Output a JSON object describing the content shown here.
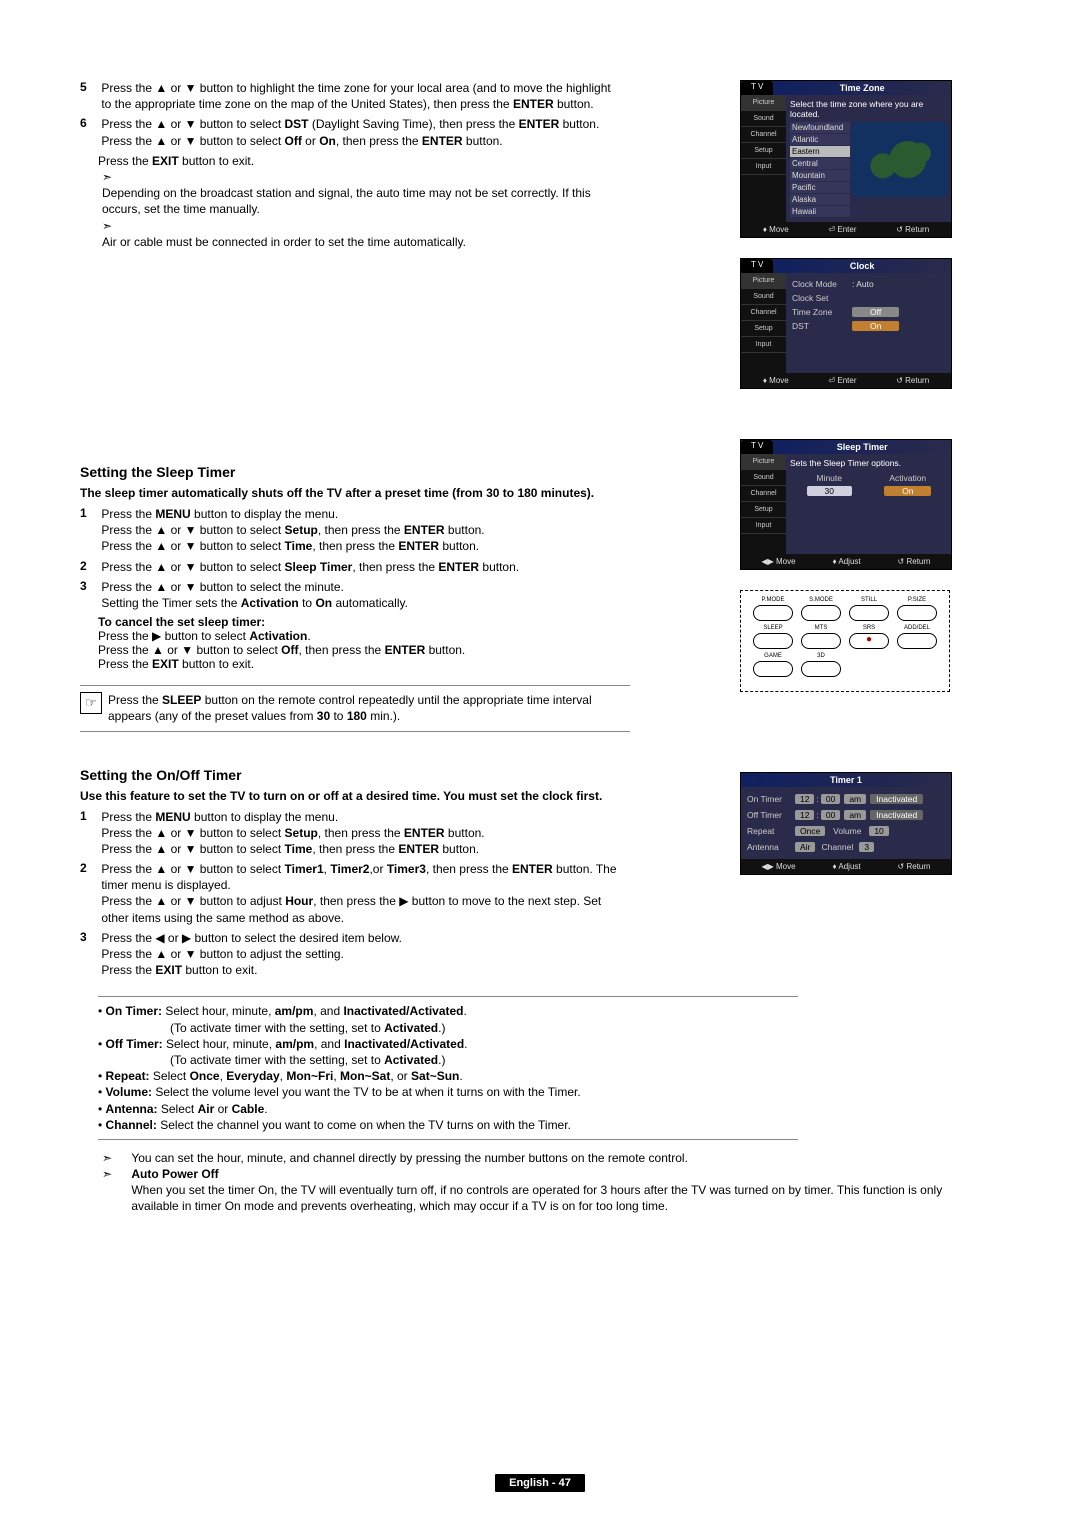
{
  "steps_top": {
    "n5": "5",
    "t5_a": "Press the ▲ or ▼ button to highlight the time zone for your local area (and to move the highlight to the appropriate time zone on the map of the United States), then press the ",
    "t5_b": "ENTER",
    "t5_c": " button.",
    "n6": "6",
    "t6_a": "Press the ▲ or ▼ button to select ",
    "t6_b": "DST",
    "t6_c": " (Daylight Saving Time), then press the ",
    "t6_d": "ENTER",
    "t6_e": " button. Press the ▲ or ▼ button to select ",
    "t6_f": "Off",
    "t6_g": " or ",
    "t6_h": "On",
    "t6_i": ", then press the ",
    "t6_j": "ENTER",
    "t6_k": " button.",
    "exit_a": "Press the ",
    "exit_b": "EXIT",
    "exit_c": " button to exit.",
    "arrow1": "Depending on the broadcast station and signal, the auto time may not be set correctly. If this occurs, set the time manually.",
    "arrow2": "Air or cable must be connected in order to set the time automatically."
  },
  "sleep": {
    "heading": "Setting the Sleep Timer",
    "intro": "The sleep timer automatically shuts off the TV after a preset time (from 30 to 180 minutes).",
    "n1": "1",
    "s1a": "Press the ",
    "s1b": "MENU",
    "s1c": " button to display the menu.",
    "s1d": "Press the ▲ or ▼ button to select ",
    "s1e": "Setup",
    "s1f": ", then press the ",
    "s1g": "ENTER",
    "s1h": " button.",
    "s1i": "Press the ▲ or ▼ button to select ",
    "s1j": "Time",
    "s1k": ", then press the ",
    "s1l": "ENTER",
    "s1m": " button.",
    "n2": "2",
    "s2a": "Press the ▲ or ▼ button to select ",
    "s2b": "Sleep Timer",
    "s2c": ", then press the ",
    "s2d": "ENTER",
    "s2e": " button.",
    "n3": "3",
    "s3a": "Press the ▲ or ▼ button to select the minute.",
    "s3b": "Setting the Timer sets the ",
    "s3c": "Activation",
    "s3d": " to ",
    "s3e": "On",
    "s3f": " automatically.",
    "cancel_head": "To cancel the set sleep timer:",
    "c1a": "Press the ▶ button to select ",
    "c1b": "Activation",
    "c1c": ".",
    "c2a": "Press the ▲ or ▼ button to select ",
    "c2b": "Off",
    "c2c": ", then press the ",
    "c2d": "ENTER",
    "c2e": " button.",
    "c3a": "Press the ",
    "c3b": "EXIT",
    "c3c": " button to exit.",
    "tip_a": "Press the ",
    "tip_b": "SLEEP",
    "tip_c": " button on the remote control repeatedly until the appropriate time interval appears (any of the preset values from ",
    "tip_d": "30",
    "tip_e": " to ",
    "tip_f": "180",
    "tip_g": " min.)."
  },
  "onoff": {
    "heading": "Setting the On/Off Timer",
    "intro": "Use this feature to set the TV to turn on or off at a desired time. You must set the clock first.",
    "n1": "1",
    "s1a": "Press the ",
    "s1b": "MENU",
    "s1c": " button to display the menu.",
    "s1d": "Press the ▲ or ▼ button to select ",
    "s1e": "Setup",
    "s1f": ", then press the ",
    "s1g": "ENTER",
    "s1h": " button.",
    "s1i": "Press the ▲ or ▼ button to select ",
    "s1j": "Time",
    "s1k": ", then press the ",
    "s1l": "ENTER",
    "s1m": " button.",
    "n2": "2",
    "s2a": "Press the ▲ or ▼ button to select ",
    "s2b": "Timer1",
    "s2c": ", ",
    "s2d": "Timer2",
    "s2e": ",or ",
    "s2f": "Timer3",
    "s2g": ", then press the ",
    "s2h": "ENTER",
    "s2i": " button. The timer menu is displayed.",
    "s2j": "Press the ▲ or ▼ button to adjust ",
    "s2k": "Hour",
    "s2l": ", then press the ▶ button to move to the next step. Set other items using the same method as above.",
    "n3": "3",
    "s3a": "Press the ◀ or ▶ button to select the desired item below.",
    "s3b": "Press the ▲ or ▼ button to adjust the setting.",
    "s3ca": "Press the ",
    "s3cb": "EXIT",
    "s3cc": " button to exit.",
    "b1a": "On Timer:",
    "b1b": " Select hour, minute, ",
    "b1c": "am/pm",
    "b1d": ", and ",
    "b1e": "Inactivated/Activated",
    "b1f": ".",
    "b1g": "(To activate timer with the setting, set to ",
    "b1h": "Activated",
    "b1i": ".)",
    "b2a": "Off Timer:",
    "b2b": " Select hour, minute, ",
    "b2c": "am/pm",
    "b2d": ", and ",
    "b2e": "Inactivated/Activated",
    "b2f": ".",
    "b2g": "(To activate timer with the setting, set to ",
    "b2h": "Activated",
    "b2i": ".)",
    "b3a": "Repeat:",
    "b3b": " Select ",
    "b3c": "Once",
    "b3d": ", ",
    "b3e": "Everyday",
    "b3f": ", ",
    "b3g": "Mon~Fri",
    "b3h": ", ",
    "b3i": "Mon~Sat",
    "b3j": ", or ",
    "b3k": "Sat~Sun",
    "b3l": ".",
    "b4a": "Volume:",
    "b4b": " Select the volume level you want the TV to be at when it turns on with the Timer.",
    "b5a": "Antenna:",
    "b5b": " Select ",
    "b5c": "Air",
    "b5d": " or ",
    "b5e": "Cable",
    "b5f": ".",
    "b6a": "Channel:",
    "b6b": " Select the channel you want to come on when the TV turns on with the Timer.",
    "arrow_bottom": "You can set the hour, minute, and channel directly by pressing the number buttons on the remote control.",
    "apo_head": "Auto Power Off",
    "apo_body": "When you set the timer On, the TV will eventually turn off, if no controls are operated for 3 hours after the TV was turned on by timer. This function is only available in timer On mode and prevents overheating, which may occur if a TV is on for too long time."
  },
  "osd": {
    "tv": "T V",
    "timezone_title": "Time Zone",
    "timezone_banner": "Select the time zone where you are located.",
    "side": {
      "picture": "Picture",
      "sound": "Sound",
      "channel": "Channel",
      "setup": "Setup",
      "input": "Input"
    },
    "tz_list": [
      "Newfoundland",
      "Atlantic",
      "Eastern",
      "Central",
      "Mountain",
      "Pacific",
      "Alaska",
      "Hawaii"
    ],
    "tz_sel": "Eastern",
    "foot_move": "Move",
    "foot_enter": "Enter",
    "foot_return": "Return",
    "clock_title": "Clock",
    "clock_mode_l": "Clock Mode",
    "clock_mode_v": ": Auto",
    "clock_set": "Clock Set",
    "clock_tz": "Time Zone",
    "clock_dst": "DST",
    "off": "Off",
    "on": "On",
    "sleep_title": "Sleep Timer",
    "sleep_banner": "Sets the Sleep Timer options.",
    "sleep_minute": "Minute",
    "sleep_activation": "Activation",
    "sleep_minute_v": "30",
    "sleep_act_v": "On",
    "foot_lr": "Move",
    "foot_adjust": "Adjust",
    "timer1_title": "Timer 1",
    "on_timer": "On Timer",
    "off_timer": "Off Timer",
    "repeat": "Repeat",
    "antenna": "Antenna",
    "volume": "Volume",
    "channel_l": "Channel",
    "hr12": "12",
    "min00": "00",
    "ampm": "am",
    "inact": "Inactivated",
    "once": "Once",
    "vol10": "10",
    "air": "Air",
    "ch3": "3"
  },
  "remote": {
    "pmode": "P.MODE",
    "smode": "S.MODE",
    "still": "STILL",
    "psize": "P.SIZE",
    "sleep": "SLEEP",
    "mts": "MTS",
    "srs": "SRS",
    "adddel": "ADD/DEL",
    "game": "GAME",
    "d3": "3D"
  },
  "pagefoot": "English - 47"
}
